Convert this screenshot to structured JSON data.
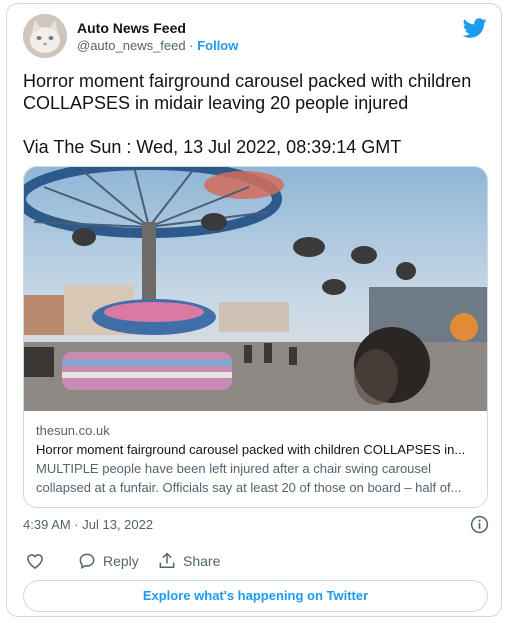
{
  "author": {
    "name": "Auto News Feed",
    "handle": "@auto_news_feed",
    "separator": "·",
    "follow_label": "Follow"
  },
  "tweet": {
    "line1": "Horror moment fairground carousel packed with children",
    "line2": "COLLAPSES in midair leaving 20 people injured",
    "via": "Via The Sun : Wed, 13 Jul 2022, 08:39:14 GMT"
  },
  "link_card": {
    "domain": "thesun.co.uk",
    "title": "Horror moment fairground carousel packed with children COLLAPSES in...",
    "desc_line1": "MULTIPLE people have been left injured after a chair swing carousel",
    "desc_line2": "collapsed at a funfair. Officials say at least 20 of those on board – half of..."
  },
  "timestamp": "4:39 AM · Jul 13, 2022",
  "actions": {
    "reply_label": "Reply",
    "share_label": "Share"
  },
  "explore_label": "Explore what's happening on Twitter",
  "colors": {
    "accent": "#1d9bf0",
    "text": "#0f1419",
    "muted": "#536471",
    "border": "#cfd9de"
  },
  "icons": [
    "twitter-bird-icon",
    "info-icon",
    "heart-icon",
    "reply-icon",
    "share-icon"
  ]
}
